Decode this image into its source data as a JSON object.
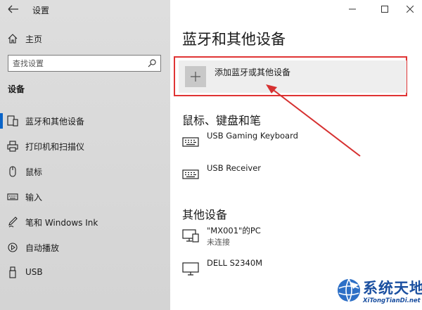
{
  "window": {
    "title": "设置",
    "controls": {
      "minimize": "minimize-icon",
      "maximize": "maximize-icon",
      "close": "close-icon"
    }
  },
  "sidebar": {
    "home_label": "主页",
    "search_placeholder": "查找设置",
    "section_title": "设备",
    "items": [
      {
        "label": "蓝牙和其他设备",
        "icon": "bluetooth-devices-icon",
        "active": true
      },
      {
        "label": "打印机和扫描仪",
        "icon": "printer-icon",
        "active": false
      },
      {
        "label": "鼠标",
        "icon": "mouse-icon",
        "active": false
      },
      {
        "label": "输入",
        "icon": "keyboard-icon",
        "active": false
      },
      {
        "label": "笔和 Windows Ink",
        "icon": "pen-icon",
        "active": false
      },
      {
        "label": "自动播放",
        "icon": "autoplay-icon",
        "active": false
      },
      {
        "label": "USB",
        "icon": "usb-icon",
        "active": false
      }
    ]
  },
  "main": {
    "title": "蓝牙和其他设备",
    "add_device_label": "添加蓝牙或其他设备",
    "mouse_section_title": "鼠标、键盘和笔",
    "mouse_devices": [
      {
        "name": "USB Gaming Keyboard",
        "icon": "keyboard-icon"
      },
      {
        "name": "USB Receiver",
        "icon": "keyboard-icon"
      }
    ],
    "other_section_title": "其他设备",
    "other_devices": [
      {
        "name": "\"MX001\"的PC",
        "status": "未连接",
        "icon": "pc-icon"
      },
      {
        "name": "DELL S2340M",
        "icon": "monitor-icon"
      }
    ]
  },
  "watermark": {
    "title": "系统天地",
    "url": "XiTongTianDi.net"
  },
  "colors": {
    "accent": "#0a64c8",
    "highlight_border": "#e03434",
    "sidebar_bg": "#d8d8d8",
    "watermark_blue": "#1a4fa0"
  }
}
